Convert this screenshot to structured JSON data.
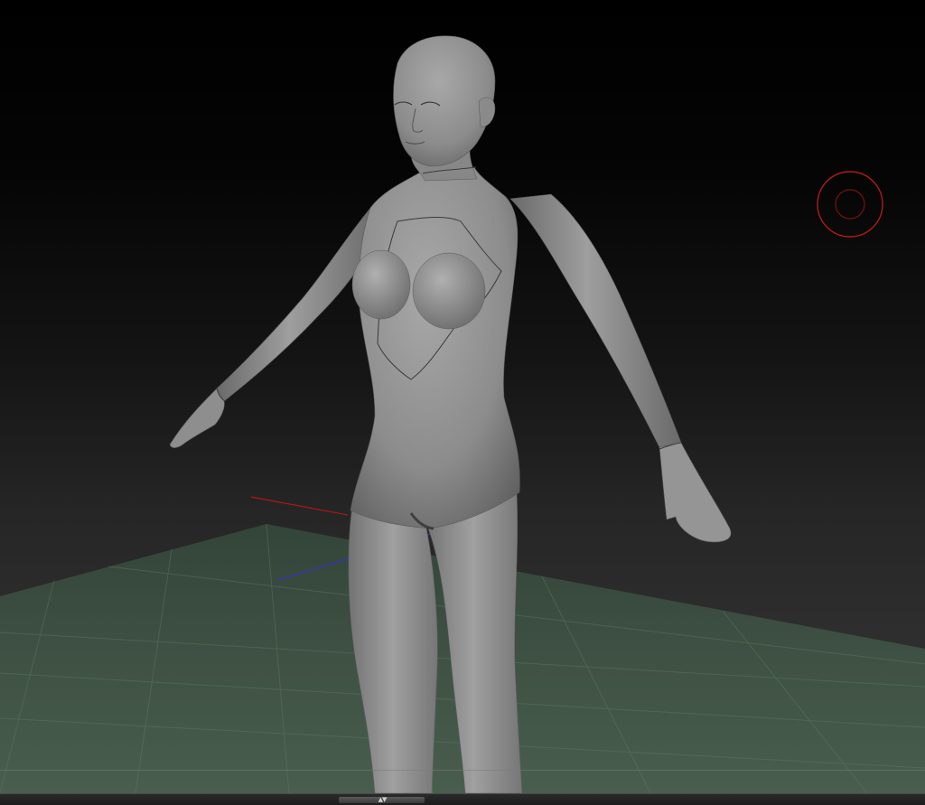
{
  "viewport": {
    "background_top": "#000000",
    "background_bottom": "#333333",
    "floor_color": "#3f5a3f",
    "model_color": "#8a8a8a",
    "brush_cursor_color": "#b01a1a",
    "axis_x_color": "#c02020",
    "axis_z_color": "#3a3ad0",
    "axis_y_color": "#20c020"
  },
  "icons": {
    "brush_cursor": "brush-cursor-icon",
    "resize_grip": "resize-grip-icon"
  },
  "bottom_bar": {
    "resize_arrows": "▲▼"
  }
}
